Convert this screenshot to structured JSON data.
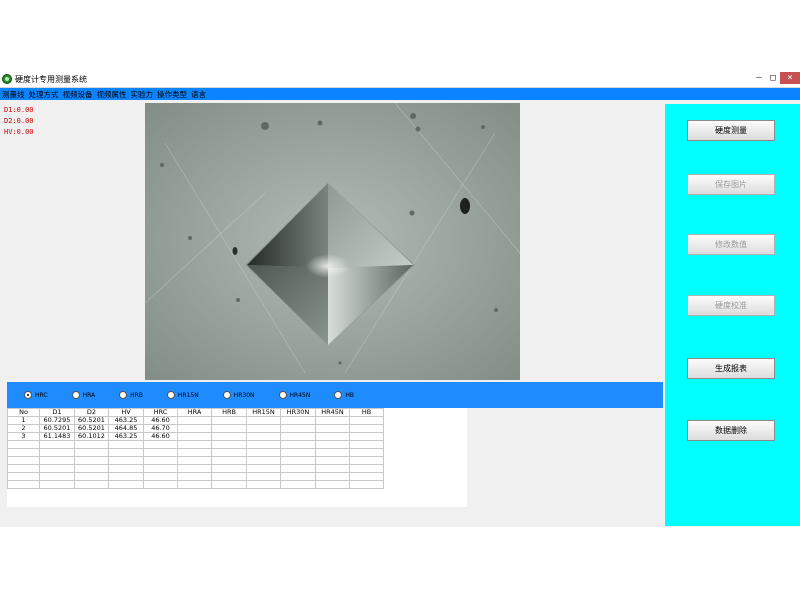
{
  "window": {
    "title": "硬度计专用测量系统",
    "controls": [
      "–",
      "□",
      "×"
    ]
  },
  "menu": [
    "测量线",
    "处理方式",
    "视频设备",
    "视频属性",
    "实验力",
    "操作类型",
    "语言"
  ],
  "readouts": [
    "D1:0.00",
    "D2:0.00",
    "HV:0.00"
  ],
  "scale_options": [
    {
      "label": "HRC",
      "checked": true
    },
    {
      "label": "HRA",
      "checked": false
    },
    {
      "label": "HRB",
      "checked": false
    },
    {
      "label": "HR15N",
      "checked": false
    },
    {
      "label": "HR30N",
      "checked": false
    },
    {
      "label": "HR45N",
      "checked": false
    },
    {
      "label": "HB",
      "checked": false
    }
  ],
  "table": {
    "headers": [
      "No",
      "D1",
      "D2",
      "HV",
      "HRC",
      "HRA",
      "HRB",
      "HR15N",
      "HR30N",
      "HR45N",
      "HB"
    ],
    "rows": [
      [
        "1",
        "60.7295",
        "60.5201",
        "463.25",
        "46.60",
        "",
        "",
        "",
        "",
        "",
        ""
      ],
      [
        "2",
        "60.5201",
        "60.5201",
        "464.85",
        "46.70",
        "",
        "",
        "",
        "",
        "",
        ""
      ],
      [
        "3",
        "61.1483",
        "60.1012",
        "463.25",
        "46.60",
        "",
        "",
        "",
        "",
        "",
        ""
      ],
      [
        "",
        "",
        "",
        "",
        "",
        "",
        "",
        "",
        "",
        "",
        ""
      ],
      [
        "",
        "",
        "",
        "",
        "",
        "",
        "",
        "",
        "",
        "",
        ""
      ],
      [
        "",
        "",
        "",
        "",
        "",
        "",
        "",
        "",
        "",
        "",
        ""
      ],
      [
        "",
        "",
        "",
        "",
        "",
        "",
        "",
        "",
        "",
        "",
        ""
      ],
      [
        "",
        "",
        "",
        "",
        "",
        "",
        "",
        "",
        "",
        "",
        ""
      ],
      [
        "",
        "",
        "",
        "",
        "",
        "",
        "",
        "",
        "",
        "",
        ""
      ]
    ]
  },
  "side_buttons": [
    {
      "label": "硬度测量",
      "enabled": true
    },
    {
      "label": "保存图片",
      "enabled": false
    },
    {
      "label": "修改数值",
      "enabled": false
    },
    {
      "label": "硬度校准",
      "enabled": false
    },
    {
      "label": "生成报表",
      "enabled": true
    },
    {
      "label": "数据删除",
      "enabled": true
    }
  ],
  "colors": {
    "menubar": "#0a84ff",
    "options_bar": "#1e8bff",
    "side_panel": "#00ffff",
    "readout_text": "#cc0000"
  }
}
